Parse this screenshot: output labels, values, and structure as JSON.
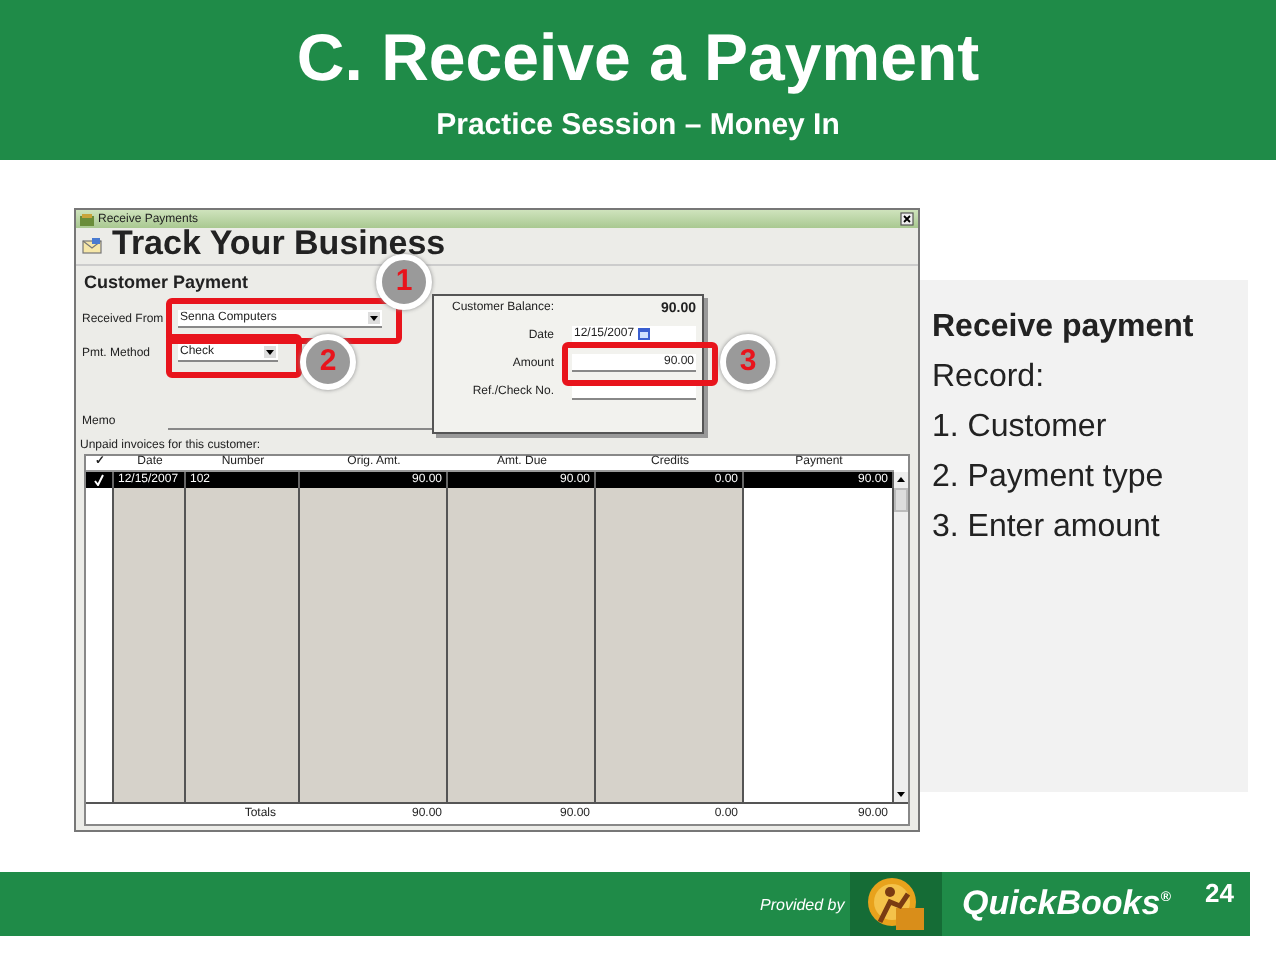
{
  "slide": {
    "title": "C. Receive a Payment",
    "subtitle": "Practice Session – Money In",
    "overlay_title": "Track Your Business"
  },
  "window": {
    "title": "Receive Payments",
    "heading": "Customer Payment",
    "left_fields": [
      {
        "kind": "combo",
        "label": "Received From",
        "value": "Senna Computers"
      },
      {
        "kind": "combo",
        "label": "Pmt. Method",
        "value": "Check"
      },
      {
        "kind": "line",
        "label": "Memo"
      }
    ],
    "balance": {
      "label": "Customer Balance:",
      "value": "90.00"
    },
    "right_fields": [
      {
        "kind": "date",
        "label": "Date",
        "value": "12/15/2007"
      },
      {
        "kind": "text",
        "label": "Amount",
        "value": "90.00"
      },
      {
        "kind": "text",
        "label": "Ref./Check No."
      }
    ],
    "table": {
      "caption": "Unpaid invoices for this customer:",
      "check_column": "✓",
      "columns": [
        "Date",
        "Number",
        "Orig. Amt.",
        "Amt. Due",
        "Credits",
        "Payment"
      ],
      "rows": [
        {
          "checked": true,
          "selected": true,
          "cells": [
            "12/15/2007",
            "102",
            "90.00",
            "90.00",
            "0.00",
            "90.00"
          ]
        }
      ],
      "totals": {
        "label": "Totals",
        "values": [
          "90.00",
          "90.00",
          "0.00",
          "90.00"
        ]
      }
    }
  },
  "callouts": [
    {
      "number": "1"
    },
    {
      "number": "2"
    },
    {
      "number": "3"
    }
  ],
  "notes": {
    "heading": "Receive payment",
    "items": [
      "Record:",
      "1. Customer",
      "2. Payment type",
      "3. Enter amount"
    ]
  },
  "footer": {
    "provided_by": "Provided by",
    "brand": "QuickBooks$^{®}$",
    "page": "24"
  }
}
